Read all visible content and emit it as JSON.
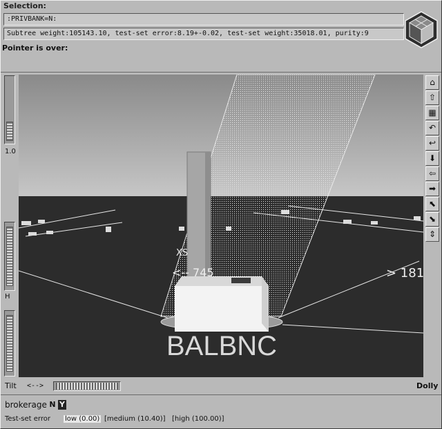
{
  "header": {
    "selection_label": "Selection:",
    "selection_value": ":PRIVBANK=N:",
    "subtree_info": "Subtree weight:105143.10, test-set error:8.19+-0.02,  test-set weight:35018.01, purity:9",
    "pointer_label": "Pointer is over:",
    "pointer_value": ""
  },
  "left_controls": {
    "scale_label": "1.0",
    "height_label": "H"
  },
  "scene": {
    "node_title": "BALBNC",
    "left_split_label": "<--  745",
    "right_split_label": "> 181",
    "xs_label": "XS",
    "colors": {
      "ground": "#2c2c2c",
      "sky_top": "#8a8a8a",
      "sky_bottom": "#c4c4c4",
      "box": "#f2f2f2"
    }
  },
  "toolbar": {
    "items": [
      {
        "name": "home-icon",
        "glyph": "⌂"
      },
      {
        "name": "home-up-icon",
        "glyph": "⇧"
      },
      {
        "name": "grid-icon",
        "glyph": "▦"
      },
      {
        "name": "undo-icon",
        "glyph": "↶"
      },
      {
        "name": "back-icon",
        "glyph": "↩"
      },
      {
        "name": "down-arrow-icon",
        "glyph": "⬇"
      },
      {
        "name": "left-arrow-icon",
        "glyph": "⇦"
      },
      {
        "name": "right-arrow-icon",
        "glyph": "➡"
      },
      {
        "name": "up-left-arrow-icon",
        "glyph": "⬉"
      },
      {
        "name": "down-right-arrow-icon",
        "glyph": "⬊"
      },
      {
        "name": "up-down-arrow-icon",
        "glyph": "⇕"
      }
    ]
  },
  "bottom": {
    "tilt_label": "Tilt",
    "tilt_arrows": "<-->",
    "dolly_label": "Dolly",
    "attribute_label": "brokerage",
    "option_n": "N",
    "option_y": "Y",
    "error_label": "Test-set error",
    "error_options": [
      "low (0.00)",
      "[medium (10.40)]",
      "[high (100.00)]"
    ]
  }
}
